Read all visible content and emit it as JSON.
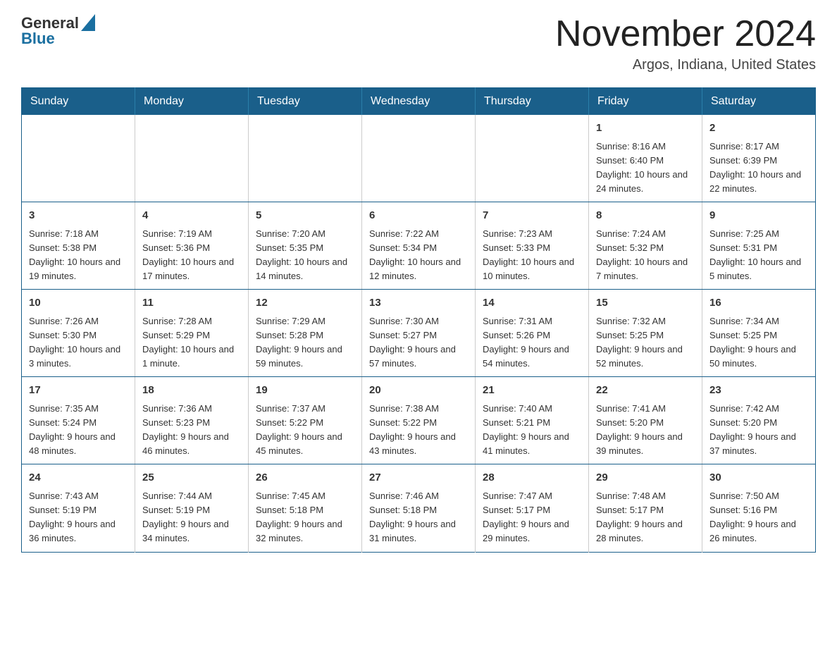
{
  "logo": {
    "general": "General",
    "blue": "Blue"
  },
  "title": "November 2024",
  "subtitle": "Argos, Indiana, United States",
  "weekdays": [
    "Sunday",
    "Monday",
    "Tuesday",
    "Wednesday",
    "Thursday",
    "Friday",
    "Saturday"
  ],
  "weeks": [
    [
      {
        "day": "",
        "info": ""
      },
      {
        "day": "",
        "info": ""
      },
      {
        "day": "",
        "info": ""
      },
      {
        "day": "",
        "info": ""
      },
      {
        "day": "",
        "info": ""
      },
      {
        "day": "1",
        "info": "Sunrise: 8:16 AM\nSunset: 6:40 PM\nDaylight: 10 hours and 24 minutes."
      },
      {
        "day": "2",
        "info": "Sunrise: 8:17 AM\nSunset: 6:39 PM\nDaylight: 10 hours and 22 minutes."
      }
    ],
    [
      {
        "day": "3",
        "info": "Sunrise: 7:18 AM\nSunset: 5:38 PM\nDaylight: 10 hours and 19 minutes."
      },
      {
        "day": "4",
        "info": "Sunrise: 7:19 AM\nSunset: 5:36 PM\nDaylight: 10 hours and 17 minutes."
      },
      {
        "day": "5",
        "info": "Sunrise: 7:20 AM\nSunset: 5:35 PM\nDaylight: 10 hours and 14 minutes."
      },
      {
        "day": "6",
        "info": "Sunrise: 7:22 AM\nSunset: 5:34 PM\nDaylight: 10 hours and 12 minutes."
      },
      {
        "day": "7",
        "info": "Sunrise: 7:23 AM\nSunset: 5:33 PM\nDaylight: 10 hours and 10 minutes."
      },
      {
        "day": "8",
        "info": "Sunrise: 7:24 AM\nSunset: 5:32 PM\nDaylight: 10 hours and 7 minutes."
      },
      {
        "day": "9",
        "info": "Sunrise: 7:25 AM\nSunset: 5:31 PM\nDaylight: 10 hours and 5 minutes."
      }
    ],
    [
      {
        "day": "10",
        "info": "Sunrise: 7:26 AM\nSunset: 5:30 PM\nDaylight: 10 hours and 3 minutes."
      },
      {
        "day": "11",
        "info": "Sunrise: 7:28 AM\nSunset: 5:29 PM\nDaylight: 10 hours and 1 minute."
      },
      {
        "day": "12",
        "info": "Sunrise: 7:29 AM\nSunset: 5:28 PM\nDaylight: 9 hours and 59 minutes."
      },
      {
        "day": "13",
        "info": "Sunrise: 7:30 AM\nSunset: 5:27 PM\nDaylight: 9 hours and 57 minutes."
      },
      {
        "day": "14",
        "info": "Sunrise: 7:31 AM\nSunset: 5:26 PM\nDaylight: 9 hours and 54 minutes."
      },
      {
        "day": "15",
        "info": "Sunrise: 7:32 AM\nSunset: 5:25 PM\nDaylight: 9 hours and 52 minutes."
      },
      {
        "day": "16",
        "info": "Sunrise: 7:34 AM\nSunset: 5:25 PM\nDaylight: 9 hours and 50 minutes."
      }
    ],
    [
      {
        "day": "17",
        "info": "Sunrise: 7:35 AM\nSunset: 5:24 PM\nDaylight: 9 hours and 48 minutes."
      },
      {
        "day": "18",
        "info": "Sunrise: 7:36 AM\nSunset: 5:23 PM\nDaylight: 9 hours and 46 minutes."
      },
      {
        "day": "19",
        "info": "Sunrise: 7:37 AM\nSunset: 5:22 PM\nDaylight: 9 hours and 45 minutes."
      },
      {
        "day": "20",
        "info": "Sunrise: 7:38 AM\nSunset: 5:22 PM\nDaylight: 9 hours and 43 minutes."
      },
      {
        "day": "21",
        "info": "Sunrise: 7:40 AM\nSunset: 5:21 PM\nDaylight: 9 hours and 41 minutes."
      },
      {
        "day": "22",
        "info": "Sunrise: 7:41 AM\nSunset: 5:20 PM\nDaylight: 9 hours and 39 minutes."
      },
      {
        "day": "23",
        "info": "Sunrise: 7:42 AM\nSunset: 5:20 PM\nDaylight: 9 hours and 37 minutes."
      }
    ],
    [
      {
        "day": "24",
        "info": "Sunrise: 7:43 AM\nSunset: 5:19 PM\nDaylight: 9 hours and 36 minutes."
      },
      {
        "day": "25",
        "info": "Sunrise: 7:44 AM\nSunset: 5:19 PM\nDaylight: 9 hours and 34 minutes."
      },
      {
        "day": "26",
        "info": "Sunrise: 7:45 AM\nSunset: 5:18 PM\nDaylight: 9 hours and 32 minutes."
      },
      {
        "day": "27",
        "info": "Sunrise: 7:46 AM\nSunset: 5:18 PM\nDaylight: 9 hours and 31 minutes."
      },
      {
        "day": "28",
        "info": "Sunrise: 7:47 AM\nSunset: 5:17 PM\nDaylight: 9 hours and 29 minutes."
      },
      {
        "day": "29",
        "info": "Sunrise: 7:48 AM\nSunset: 5:17 PM\nDaylight: 9 hours and 28 minutes."
      },
      {
        "day": "30",
        "info": "Sunrise: 7:50 AM\nSunset: 5:16 PM\nDaylight: 9 hours and 26 minutes."
      }
    ]
  ]
}
